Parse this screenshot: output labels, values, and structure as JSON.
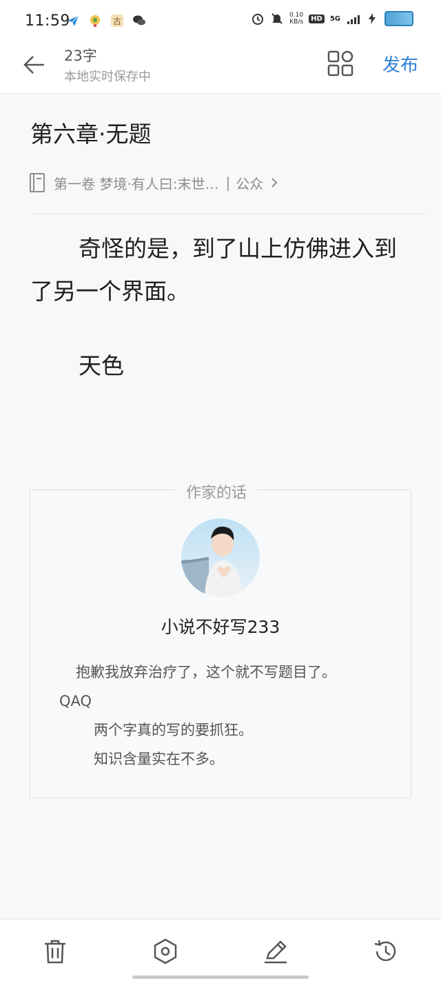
{
  "status_bar": {
    "time": "11:59",
    "net_speed_value": "0.10",
    "net_speed_unit": "KB/s",
    "hd_badge": "HD",
    "network_type": "5G",
    "left_icons": [
      "paper-plane-icon",
      "app-icon",
      "gu-icon",
      "wechat-icon"
    ],
    "right_icons": [
      "alarm-icon",
      "mute-icon",
      "charging-icon",
      "battery-icon"
    ]
  },
  "header": {
    "word_count": "23字",
    "save_status": "本地实时保存中",
    "publish_label": "发布"
  },
  "chapter": {
    "title": "第六章·无题",
    "volume_name": "第一卷 梦境·有人曰:末世…",
    "volume_separator": "|",
    "volume_type": "公众",
    "paragraphs": [
      "奇怪的是，到了山上仿佛进入到了另一个界面。",
      "天色"
    ]
  },
  "author_note": {
    "heading": "作家的话",
    "author_name": "小说不好写233",
    "lines": [
      "抱歉我放弃治疗了，这个就不写题目了。 QAQ",
      "两个字真的写的要抓狂。",
      "知识含量实在不多。"
    ]
  },
  "toolbar": {
    "items": [
      "trash-icon",
      "hexagon-settings-icon",
      "edit-pencil-icon",
      "history-icon"
    ]
  },
  "colors": {
    "accent": "#2f7fd8",
    "background": "#f6f8f9",
    "muted_text": "#9a9a9a"
  }
}
